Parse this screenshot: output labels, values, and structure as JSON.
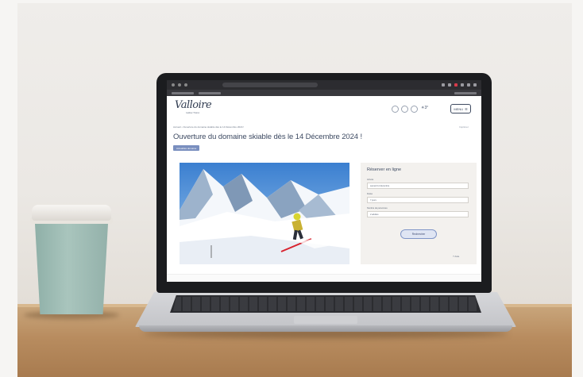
{
  "site": {
    "logo": "Valloire",
    "logo_sub": "Galibier Thabor",
    "breadcrumb": "Accueil › Ouverture du domaine skiable dès le 14 Décembre 2024 !",
    "print_label": "Imprimer",
    "weather": "3°",
    "menu_label": "MENU"
  },
  "article": {
    "title": "Ouverture du domaine skiable dès le 14 Décembre 2024 !",
    "tag": "Actualités domaine"
  },
  "login": {
    "title": "Réserver en ligne",
    "fields": [
      {
        "label": "Arrivée",
        "value": "samedi 14 décembre"
      },
      {
        "label": "Durée",
        "value": "7 jours"
      },
      {
        "label": "Nombre de personnes",
        "value": "2 adultes"
      }
    ],
    "submit_label": "Rechercher",
    "help_label": "Aide"
  },
  "colors": {
    "accent": "#7a8fbf",
    "title": "#3d4a62",
    "panel_bg": "#f3f1ee"
  }
}
